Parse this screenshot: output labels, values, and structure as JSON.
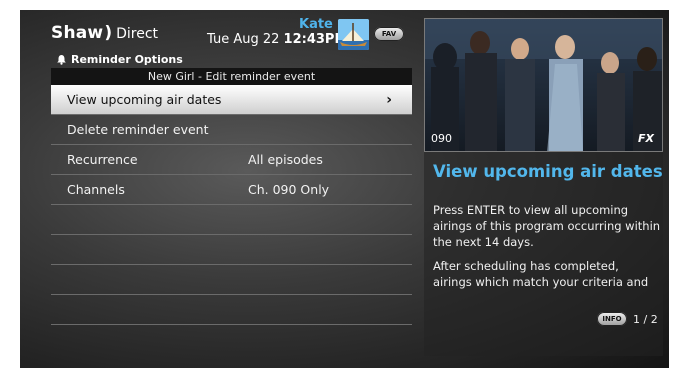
{
  "header": {
    "brand": "Shaw",
    "brand_paren": ")",
    "brand_sub": "Direct",
    "user": "Kate",
    "date": "Tue Aug 22",
    "time": "12:43PM",
    "fav_label": "FAV",
    "section": "Reminder Options"
  },
  "panel": {
    "title": "New Girl - Edit reminder event",
    "rows": [
      {
        "label": "View upcoming air dates",
        "value": "",
        "chevron": "›"
      },
      {
        "label": "Delete reminder event",
        "value": ""
      },
      {
        "label": "Recurrence",
        "value": "All episodes"
      },
      {
        "label": "Channels",
        "value": "Ch. 090 Only"
      }
    ]
  },
  "preview": {
    "channel": "090",
    "network": "FX"
  },
  "info": {
    "title": "View upcoming air dates",
    "paragraph1": "Press ENTER to view all upcoming airings of this program occurring within the next 14 days.",
    "paragraph2": "After scheduling has completed, airings which match your criteria and",
    "button_label": "INFO",
    "page": "1 / 2"
  },
  "colors": {
    "accent": "#4fb3ea",
    "selected_row": "#e6e6e6"
  }
}
